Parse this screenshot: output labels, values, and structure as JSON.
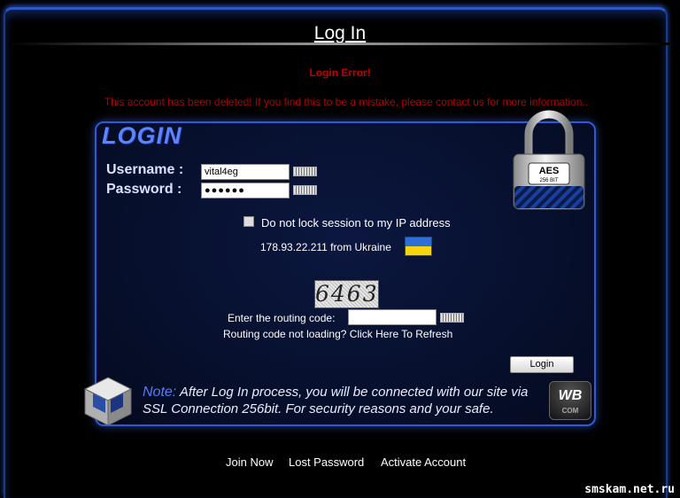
{
  "header": {
    "title": "Log In"
  },
  "error": {
    "title": "Login Error!",
    "message": "This account has been deleted! If you find this to be a mistake, please contact us for more information.."
  },
  "panel": {
    "logo_text": "LOGIN",
    "username_label": "Username :",
    "username_value": "vital4eg",
    "password_label": "Password :",
    "password_value": "●●●●●●",
    "lock_ip_label": "Do not lock session to my IP address",
    "ip_info": "178.93.22.211 from Ukraine",
    "captcha_text": "6463",
    "routing_label": "Enter the routing code:",
    "routing_value": "",
    "refresh_link": "Routing code not loading? Click Here To Refresh",
    "login_button": "Login",
    "note_keyword": "Note:",
    "note_text": " After Log In process, you will be connected with our site via SSL Connection 256bit. For security reasons and your safe.",
    "lock_badge_line1": "AES",
    "lock_badge_line2": "256 BIT",
    "brand_logo": "WB",
    "brand_sub": "COM"
  },
  "footer": {
    "join_now": "Join Now",
    "lost_password": "Lost Password",
    "activate_account": "Activate Account"
  },
  "watermark": "smskam.net.ru",
  "colors": {
    "accent_blue": "#2f59d8",
    "error_red": "#c00000",
    "flag_blue": "#2c6fd6",
    "flag_yellow": "#f7d40c"
  },
  "icons": [
    "keyboard-icon",
    "lock-icon",
    "cube-icon",
    "ukraine-flag-icon"
  ]
}
